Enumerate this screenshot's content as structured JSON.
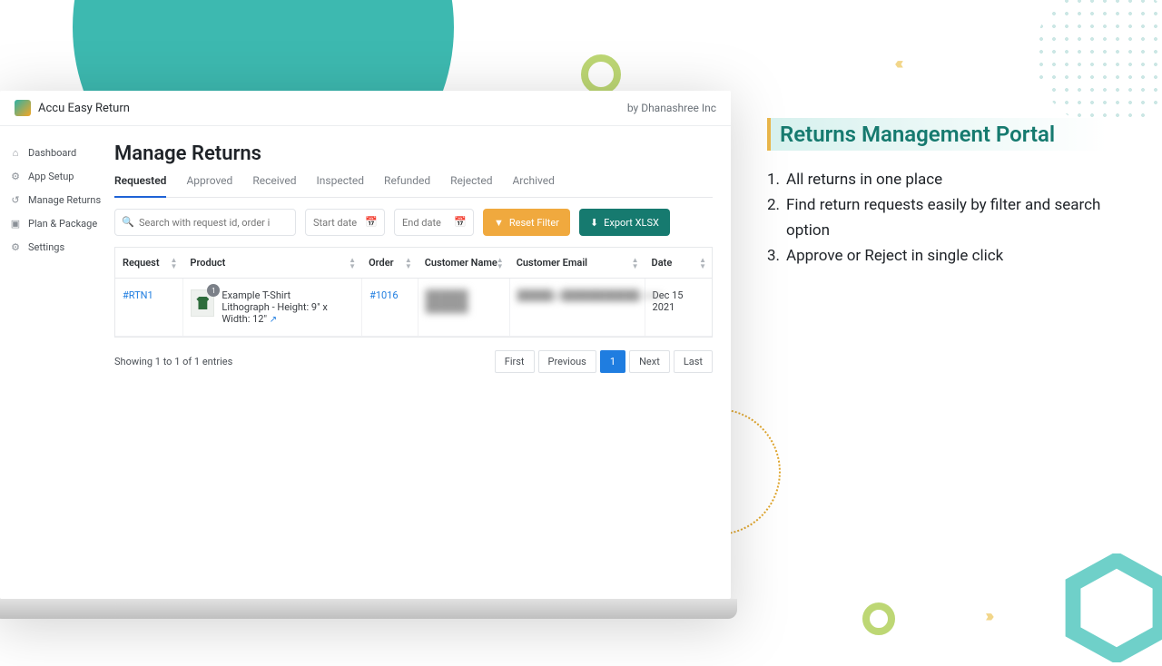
{
  "app": {
    "name": "Accu Easy Return",
    "byline": "by Dhanashree Inc"
  },
  "sidebar": {
    "items": [
      {
        "label": "Dashboard",
        "icon": "home-icon"
      },
      {
        "label": "App Setup",
        "icon": "wrench-icon"
      },
      {
        "label": "Manage Returns",
        "icon": "returns-icon"
      },
      {
        "label": "Plan & Package",
        "icon": "package-icon"
      },
      {
        "label": "Settings",
        "icon": "gear-icon"
      }
    ],
    "activeIndex": 2
  },
  "page": {
    "title": "Manage Returns"
  },
  "tabs": {
    "items": [
      "Requested",
      "Approved",
      "Received",
      "Inspected",
      "Refunded",
      "Rejected",
      "Archived"
    ],
    "activeIndex": 0
  },
  "filters": {
    "search_placeholder": "Search with request id, order id or cu",
    "start_placeholder": "Start date",
    "end_placeholder": "End date",
    "reset_label": "Reset Filter",
    "export_label": "Export XLSX"
  },
  "table": {
    "columns": [
      "Request",
      "Product",
      "Order",
      "Customer Name",
      "Customer Email",
      "Date"
    ],
    "rows": [
      {
        "request": "#RTN1",
        "product_name": "Example T-Shirt",
        "product_desc": "Lithograph - Height: 9\" x Width: 12\"",
        "qty": "1",
        "order": "#1016",
        "customer_name": "██████ ██████",
        "customer_email": "█████@███████████.com",
        "date": "Dec 15 2021"
      }
    ],
    "showing_text": "Showing 1 to 1 of 1 entries"
  },
  "pager": {
    "first": "First",
    "prev": "Previous",
    "page": "1",
    "next": "Next",
    "last": "Last"
  },
  "promo": {
    "title": "Returns Management Portal",
    "bullets": [
      "All returns in one place",
      "Find return requests easily by filter and search option",
      "Approve or Reject in single click"
    ]
  }
}
